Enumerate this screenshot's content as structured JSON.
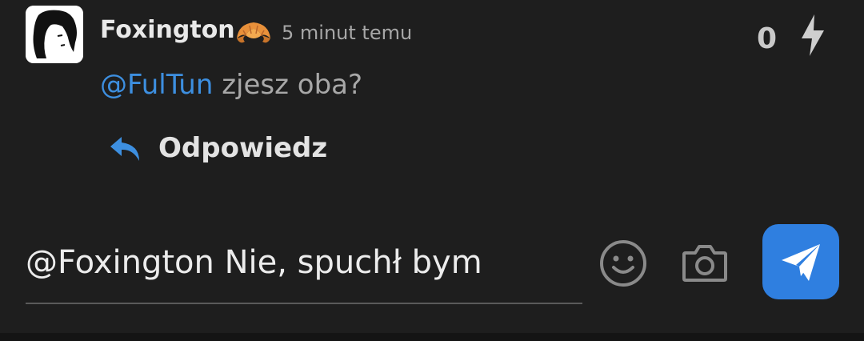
{
  "comment": {
    "author": "Foxington",
    "badge_icon": "croissant-icon",
    "time_ago": "5 minut temu",
    "score": "0",
    "vote_icon": "lightning-bolt-icon",
    "mention": "@FulTun",
    "text": " zjesz oba?",
    "reply_label": "Odpowiedz",
    "reply_icon": "reply-arrow-icon"
  },
  "compose": {
    "value": "@Foxington Nie, spuchł bym",
    "emoji_icon": "smiley-icon",
    "camera_icon": "camera-icon",
    "send_icon": "paper-plane-icon"
  },
  "colors": {
    "background": "#1e1e1e",
    "mention": "#3d8fe0",
    "send_button": "#2f7fe0",
    "badge": "#e8903a"
  }
}
